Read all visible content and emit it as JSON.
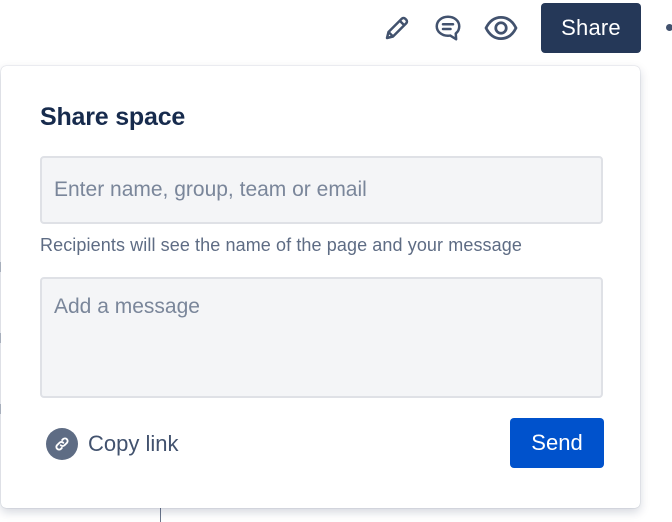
{
  "toolbar": {
    "edit_icon": "pencil-icon",
    "comment_icon": "comment-icon",
    "watch_icon": "eye-icon",
    "share_label": "Share",
    "more_icon": "more-dots-icon"
  },
  "share_popup": {
    "title": "Share space",
    "recipient_placeholder": "Enter name, group, team or email",
    "helper_text": "Recipients will see the name of the page and your message",
    "message_placeholder": "Add a message",
    "copy_link_label": "Copy link",
    "copy_link_icon": "link-icon",
    "send_label": "Send"
  },
  "colors": {
    "share_button_bg": "#253858",
    "send_button_bg": "#0052CC",
    "title_text": "#172B4D",
    "field_bg": "#F4F5F7",
    "field_border": "#DFE1E6",
    "icon_color": "#42526E"
  }
}
